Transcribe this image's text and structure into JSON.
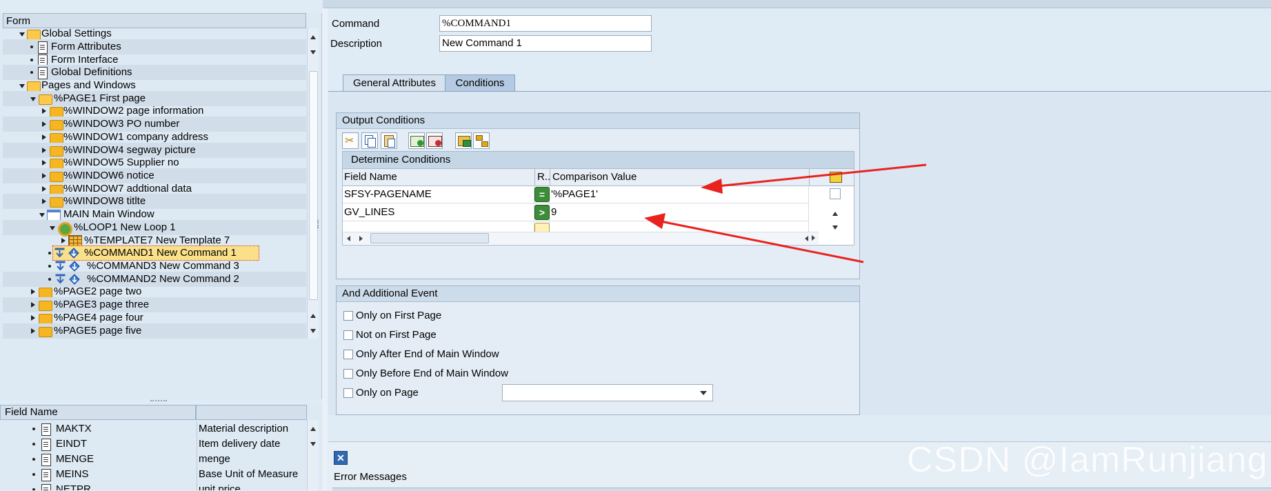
{
  "tree": {
    "header": "Form",
    "items": [
      {
        "label": "Global Settings"
      },
      {
        "label": "Form Attributes"
      },
      {
        "label": "Form Interface"
      },
      {
        "label": "Global Definitions"
      },
      {
        "label": "Pages and Windows"
      },
      {
        "label": "%PAGE1 First page"
      },
      {
        "label": "%WINDOW2 page information"
      },
      {
        "label": "%WINDOW3 PO number"
      },
      {
        "label": "%WINDOW1 company address"
      },
      {
        "label": "%WINDOW4 segway picture"
      },
      {
        "label": "%WINDOW5 Supplier no"
      },
      {
        "label": "%WINDOW6 notice"
      },
      {
        "label": "%WINDOW7 addtional data"
      },
      {
        "label": "%WINDOW8 titlte"
      },
      {
        "label": "MAIN Main Window"
      },
      {
        "label": "%LOOP1 New Loop 1"
      },
      {
        "label": "%TEMPLATE7 New Template 7"
      },
      {
        "label": "%COMMAND1 New Command 1"
      },
      {
        "label": "%COMMAND3 New Command 3"
      },
      {
        "label": "%COMMAND2 New Command 2"
      },
      {
        "label": "%PAGE2 page two"
      },
      {
        "label": "%PAGE3 page three"
      },
      {
        "label": "%PAGE4 page four"
      },
      {
        "label": "%PAGE5 page five"
      }
    ]
  },
  "field_list": {
    "header": "Field Name",
    "rows": [
      {
        "name": "MAKTX",
        "desc": "Material description"
      },
      {
        "name": "EINDT",
        "desc": "Item delivery date"
      },
      {
        "name": "MENGE",
        "desc": "menge"
      },
      {
        "name": "MEINS",
        "desc": "Base Unit of Measure"
      },
      {
        "name": "NETPR",
        "desc": "unit price"
      }
    ]
  },
  "node": {
    "command_label": "Command",
    "command_value": "%COMMAND1",
    "description_label": "Description",
    "description_value": "New Command 1"
  },
  "tabs": [
    {
      "label": "General Attributes",
      "active": false
    },
    {
      "label": "Conditions",
      "active": true
    }
  ],
  "output_conditions": {
    "title": "Output Conditions",
    "subtitle": "Determine Conditions",
    "columns": {
      "field": "Field Name",
      "rel": "R..",
      "value": "Comparison Value"
    },
    "rows": [
      {
        "field": "SFSY-PAGENAME",
        "op": "=",
        "value": "'%PAGE1'"
      },
      {
        "field": "GV_LINES",
        "op": ">",
        "value": "9"
      },
      {
        "field": "",
        "op": "",
        "value": ""
      }
    ]
  },
  "additional_event": {
    "title": "And Additional Event",
    "options": [
      {
        "label": "Only on First Page",
        "checked": false
      },
      {
        "label": "Not on First Page",
        "checked": false
      },
      {
        "label": "Only After End of Main Window",
        "checked": false
      },
      {
        "label": "Only Before End of Main Window",
        "checked": false
      },
      {
        "label": "Only on Page",
        "checked": false
      }
    ],
    "page_select_value": ""
  },
  "error_area": {
    "title": "Error Messages"
  },
  "watermark": "CSDN @IamRunjiang",
  "colors": {
    "selection": "#fbe08a",
    "arrow": "#e8231f",
    "relation_button": "#3d8c3a"
  }
}
